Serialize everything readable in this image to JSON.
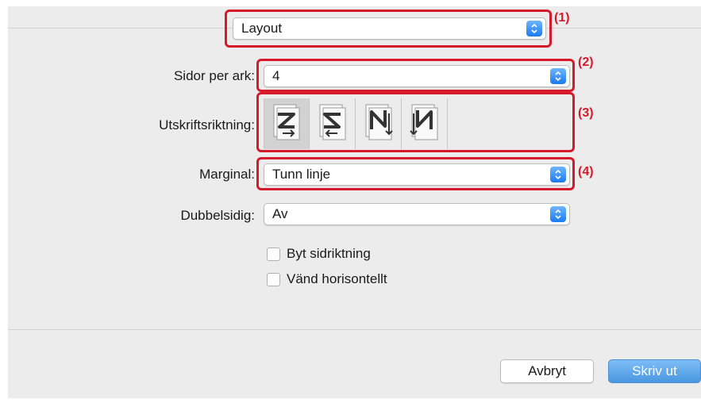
{
  "dialog": {
    "section_popup": {
      "value": "Layout",
      "callout": "(1)"
    },
    "pages_per_sheet": {
      "label": "Sidor per ark:",
      "value": "4",
      "callout": "(2)"
    },
    "layout_direction": {
      "label": "Utskriftsriktning:",
      "callout": "(3)",
      "options": [
        {
          "icon": "z-arrow-right-icon",
          "selected": true
        },
        {
          "icon": "reverse-z-arrow-left-icon",
          "selected": false
        },
        {
          "icon": "n-reverse-arrow-down-icon",
          "selected": false
        },
        {
          "icon": "n-arrow-down-icon",
          "selected": false
        }
      ]
    },
    "border": {
      "label": "Marginal:",
      "value": "Tunn linje",
      "callout": "(4)"
    },
    "two_sided": {
      "label": "Dubbelsidig:",
      "value": "Av"
    },
    "checkboxes": [
      {
        "label": "Byt sidriktning",
        "checked": false
      },
      {
        "label": "Vänd horisontellt",
        "checked": false
      }
    ],
    "buttons": {
      "cancel": "Avbryt",
      "print": "Skriv ut"
    }
  },
  "colors": {
    "accent": "#1a7af0",
    "callout": "#d6192b",
    "panel": "#ececec"
  }
}
